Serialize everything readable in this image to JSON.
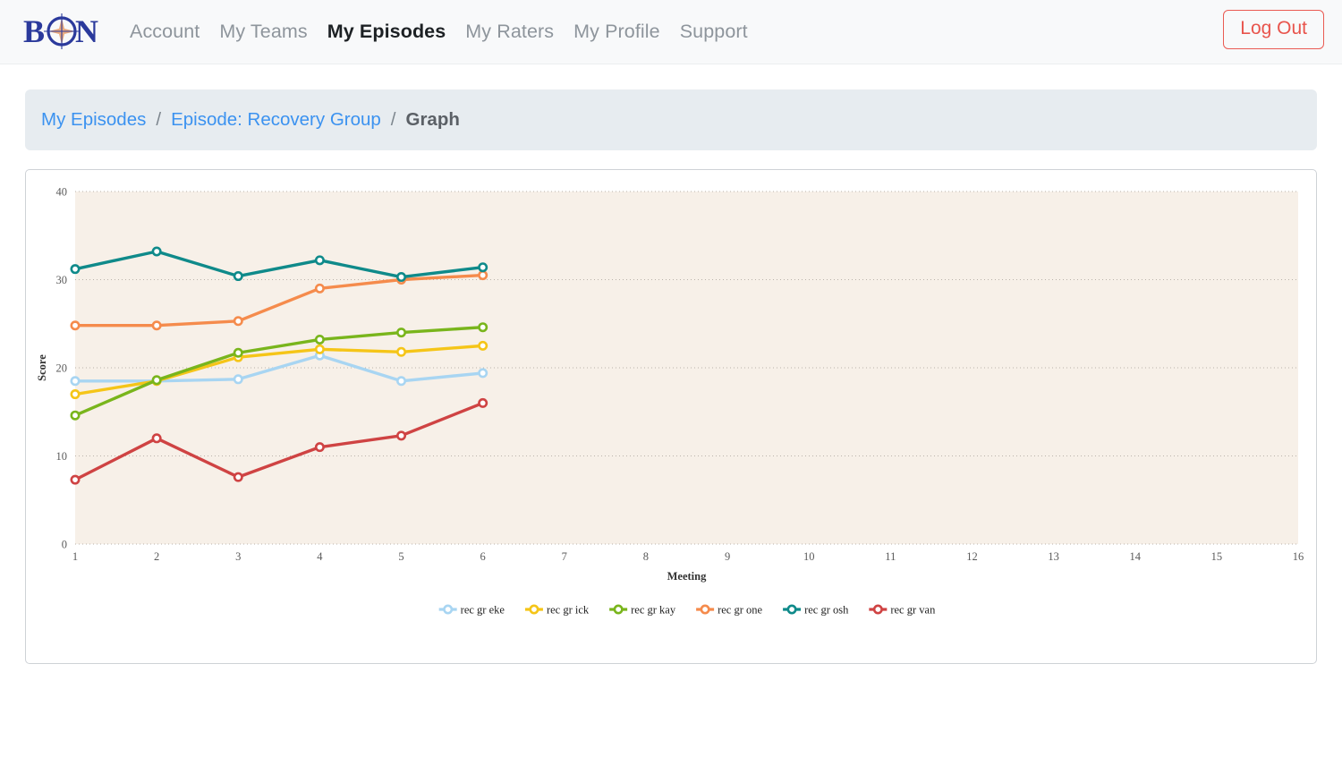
{
  "navbar": {
    "brand": {
      "text": "BON",
      "icon": "compass-rose-icon",
      "color": "#2b3a9c",
      "accent": "#e8a87c"
    },
    "links": [
      {
        "label": "Account",
        "active": false
      },
      {
        "label": "My Teams",
        "active": false
      },
      {
        "label": "My Episodes",
        "active": true
      },
      {
        "label": "My Raters",
        "active": false
      },
      {
        "label": "My Profile",
        "active": false
      },
      {
        "label": "Support",
        "active": false
      }
    ],
    "logout_label": "Log Out",
    "logout_color": "#e8544c"
  },
  "breadcrumb": {
    "items": [
      {
        "label": "My Episodes",
        "current": false
      },
      {
        "label": "Episode: Recovery Group",
        "current": false
      },
      {
        "label": "Graph",
        "current": true
      }
    ],
    "separator": "/"
  },
  "chart_data": {
    "type": "line",
    "title": "",
    "xlabel": "Meeting",
    "ylabel": "Score",
    "x": [
      1,
      2,
      3,
      4,
      5,
      6
    ],
    "xticks": [
      1,
      2,
      3,
      4,
      5,
      6,
      7,
      8,
      9,
      10,
      11,
      12,
      13,
      14,
      15,
      16
    ],
    "yticks": [
      0,
      10,
      20,
      30,
      40
    ],
    "xlim": [
      1,
      16
    ],
    "ylim": [
      0,
      40
    ],
    "grid": true,
    "grid_axis": "y",
    "legend_position": "bottom",
    "plot_bgcolor": "#f7f0e8",
    "series": [
      {
        "name": "rec gr eke",
        "color": "#a8d5f2",
        "values": [
          18.5,
          18.5,
          18.7,
          21.4,
          18.5,
          19.4
        ]
      },
      {
        "name": "rec gr ick",
        "color": "#f5c518",
        "values": [
          17.0,
          18.5,
          21.2,
          22.1,
          21.8,
          22.5
        ]
      },
      {
        "name": "rec gr kay",
        "color": "#79b51c",
        "values": [
          14.6,
          18.6,
          21.7,
          23.2,
          24.0,
          24.6
        ]
      },
      {
        "name": "rec gr one",
        "color": "#f58b4c",
        "values": [
          24.8,
          24.8,
          25.3,
          29.0,
          30.0,
          30.5
        ]
      },
      {
        "name": "rec gr osh",
        "color": "#0f8a8a",
        "values": [
          31.2,
          33.2,
          30.4,
          32.2,
          30.3,
          31.4
        ]
      },
      {
        "name": "rec gr van",
        "color": "#cf4343",
        "values": [
          7.3,
          12.0,
          7.6,
          11.0,
          12.3,
          16.0
        ]
      }
    ]
  }
}
